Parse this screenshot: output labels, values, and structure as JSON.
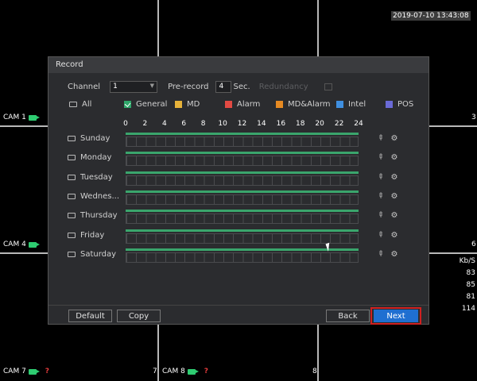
{
  "overlay": {
    "timestamp": "2019-07-10 13:43:08",
    "cameras": [
      {
        "label": "CAM 1"
      },
      {
        "label": "CAM 4"
      },
      {
        "label": "CAM 7",
        "warning": "?"
      },
      {
        "label": "CAM 8",
        "warning": "?"
      }
    ],
    "tile_numbers": {
      "n3": "3",
      "n6": "6",
      "n7": "7",
      "n8": "8"
    },
    "throughput": {
      "header": "Kb/S",
      "values": [
        "83",
        "85",
        "81",
        "114"
      ]
    }
  },
  "dialog": {
    "title": "Record",
    "channel_label": "Channel",
    "channel_value": "1",
    "prerecord_label": "Pre-record",
    "prerecord_value": "4",
    "prerecord_unit": "Sec.",
    "redundancy_label": "Redundancy",
    "legend": {
      "all": "All",
      "items": [
        {
          "label": "General",
          "color": "#2fa66a",
          "checked": true
        },
        {
          "label": "MD",
          "color": "#e7b23a"
        },
        {
          "label": "Alarm",
          "color": "#e24a43"
        },
        {
          "label": "MD&Alarm",
          "color": "#e68a22"
        },
        {
          "label": "Intel",
          "color": "#3f8fe0"
        },
        {
          "label": "POS",
          "color": "#6a6ad6"
        }
      ]
    },
    "hours": [
      "0",
      "2",
      "4",
      "6",
      "8",
      "10",
      "12",
      "14",
      "16",
      "18",
      "20",
      "22",
      "24"
    ],
    "schedule": [
      {
        "day": "Sunday",
        "general_fraction": 1.0
      },
      {
        "day": "Monday",
        "general_fraction": 1.0
      },
      {
        "day": "Tuesday",
        "general_fraction": 1.0
      },
      {
        "day": "Wednes...",
        "general_fraction": 1.0
      },
      {
        "day": "Thursday",
        "general_fraction": 1.0
      },
      {
        "day": "Friday",
        "general_fraction": 1.0
      },
      {
        "day": "Saturday",
        "general_fraction": 1.0
      }
    ],
    "buttons": {
      "default": "Default",
      "copy": "Copy",
      "back": "Back",
      "next": "Next"
    }
  }
}
